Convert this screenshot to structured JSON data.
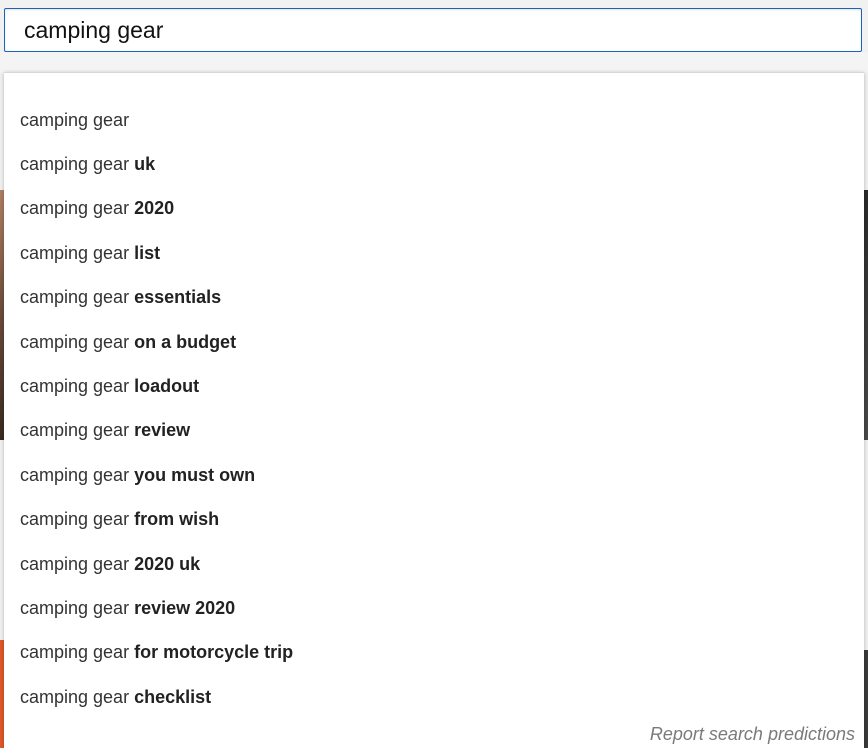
{
  "search": {
    "value": "camping gear"
  },
  "suggestions": [
    {
      "base": "camping gear",
      "completion": ""
    },
    {
      "base": "camping gear ",
      "completion": "uk"
    },
    {
      "base": "camping gear ",
      "completion": "2020"
    },
    {
      "base": "camping gear ",
      "completion": "list"
    },
    {
      "base": "camping gear ",
      "completion": "essentials"
    },
    {
      "base": "camping gear ",
      "completion": "on a budget"
    },
    {
      "base": "camping gear ",
      "completion": "loadout"
    },
    {
      "base": "camping gear ",
      "completion": "review"
    },
    {
      "base": "camping gear ",
      "completion": "you must own"
    },
    {
      "base": "camping gear ",
      "completion": "from wish"
    },
    {
      "base": "camping gear ",
      "completion": "2020 uk"
    },
    {
      "base": "camping gear ",
      "completion": "review 2020"
    },
    {
      "base": "camping gear ",
      "completion": "for motorcycle trip"
    },
    {
      "base": "camping gear ",
      "completion": "checklist"
    }
  ],
  "footer": {
    "report_label": "Report search predictions"
  },
  "colors": {
    "focus_border": "#1c62b9",
    "report_text": "#7a7a7a"
  }
}
